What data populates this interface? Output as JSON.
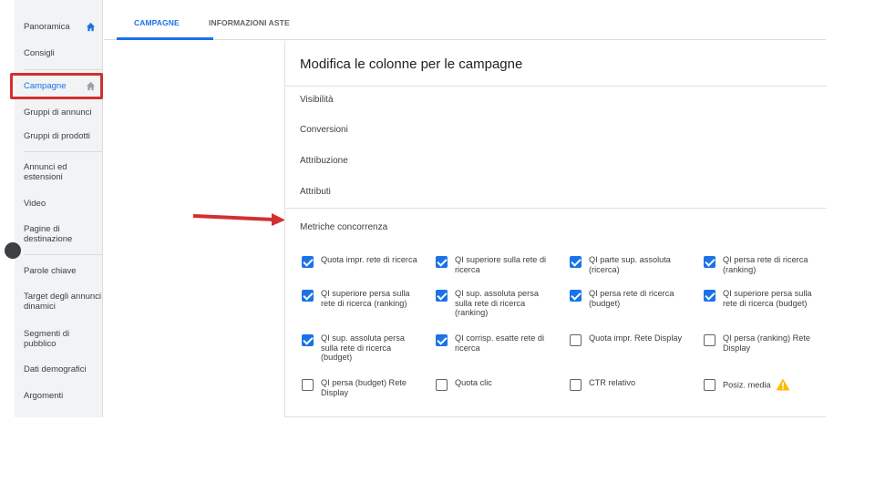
{
  "sidebar": {
    "items": [
      {
        "label": "Panoramica"
      },
      {
        "label": "Consigli"
      },
      {
        "label": "Campagne"
      },
      {
        "label": "Gruppi di annunci"
      },
      {
        "label": "Gruppi di prodotti"
      },
      {
        "label": "Annunci ed estensioni"
      },
      {
        "label": "Video"
      },
      {
        "label": "Pagine di destinazione"
      },
      {
        "label": "Parole chiave"
      },
      {
        "label": "Target degli annunci dinamici"
      },
      {
        "label": "Segmenti di pubblico"
      },
      {
        "label": "Dati demografici"
      },
      {
        "label": "Argomenti"
      }
    ],
    "active_index": 2
  },
  "tabs": [
    {
      "label": "CAMPAGNE",
      "active": true
    },
    {
      "label": "INFORMAZIONI ASTE",
      "active": false
    }
  ],
  "panel": {
    "title": "Modifica le colonne per le campagne",
    "sections": [
      {
        "label": "Visibilità"
      },
      {
        "label": "Conversioni"
      },
      {
        "label": "Attribuzione"
      },
      {
        "label": "Attributi"
      },
      {
        "label": "Metriche concorrenza"
      }
    ],
    "metrics": [
      {
        "label": "Quota impr. rete di ricerca",
        "checked": true
      },
      {
        "label": "QI superiore sulla rete di ricerca",
        "checked": true
      },
      {
        "label": "QI parte sup. assoluta (ricerca)",
        "checked": true
      },
      {
        "label": "QI persa rete di ricerca (ranking)",
        "checked": true
      },
      {
        "label": "QI superiore persa sulla rete di ricerca (ranking)",
        "checked": true
      },
      {
        "label": "QI sup. assoluta persa sulla rete di ricerca (ranking)",
        "checked": true
      },
      {
        "label": "QI persa rete di ricerca (budget)",
        "checked": true
      },
      {
        "label": "QI superiore persa sulla rete di ricerca (budget)",
        "checked": true
      },
      {
        "label": "QI sup. assoluta persa sulla rete di ricerca (budget)",
        "checked": true
      },
      {
        "label": "QI corrisp. esatte rete di ricerca",
        "checked": true
      },
      {
        "label": "Quota impr. Rete Display",
        "checked": false
      },
      {
        "label": "QI persa (ranking) Rete Display",
        "checked": false
      },
      {
        "label": "QI persa (budget) Rete Display",
        "checked": false
      },
      {
        "label": "Quota clic",
        "checked": false
      },
      {
        "label": "CTR relativo",
        "checked": false
      },
      {
        "label": "Posiz. media",
        "checked": false,
        "warning": true
      }
    ]
  },
  "colors": {
    "accent": "#1a73e8",
    "highlight": "#d32f2f",
    "warning": "#fbbc04"
  },
  "icons": {
    "home": "home-icon",
    "warning": "warning-icon",
    "arrow": "red-arrow-annotation"
  }
}
